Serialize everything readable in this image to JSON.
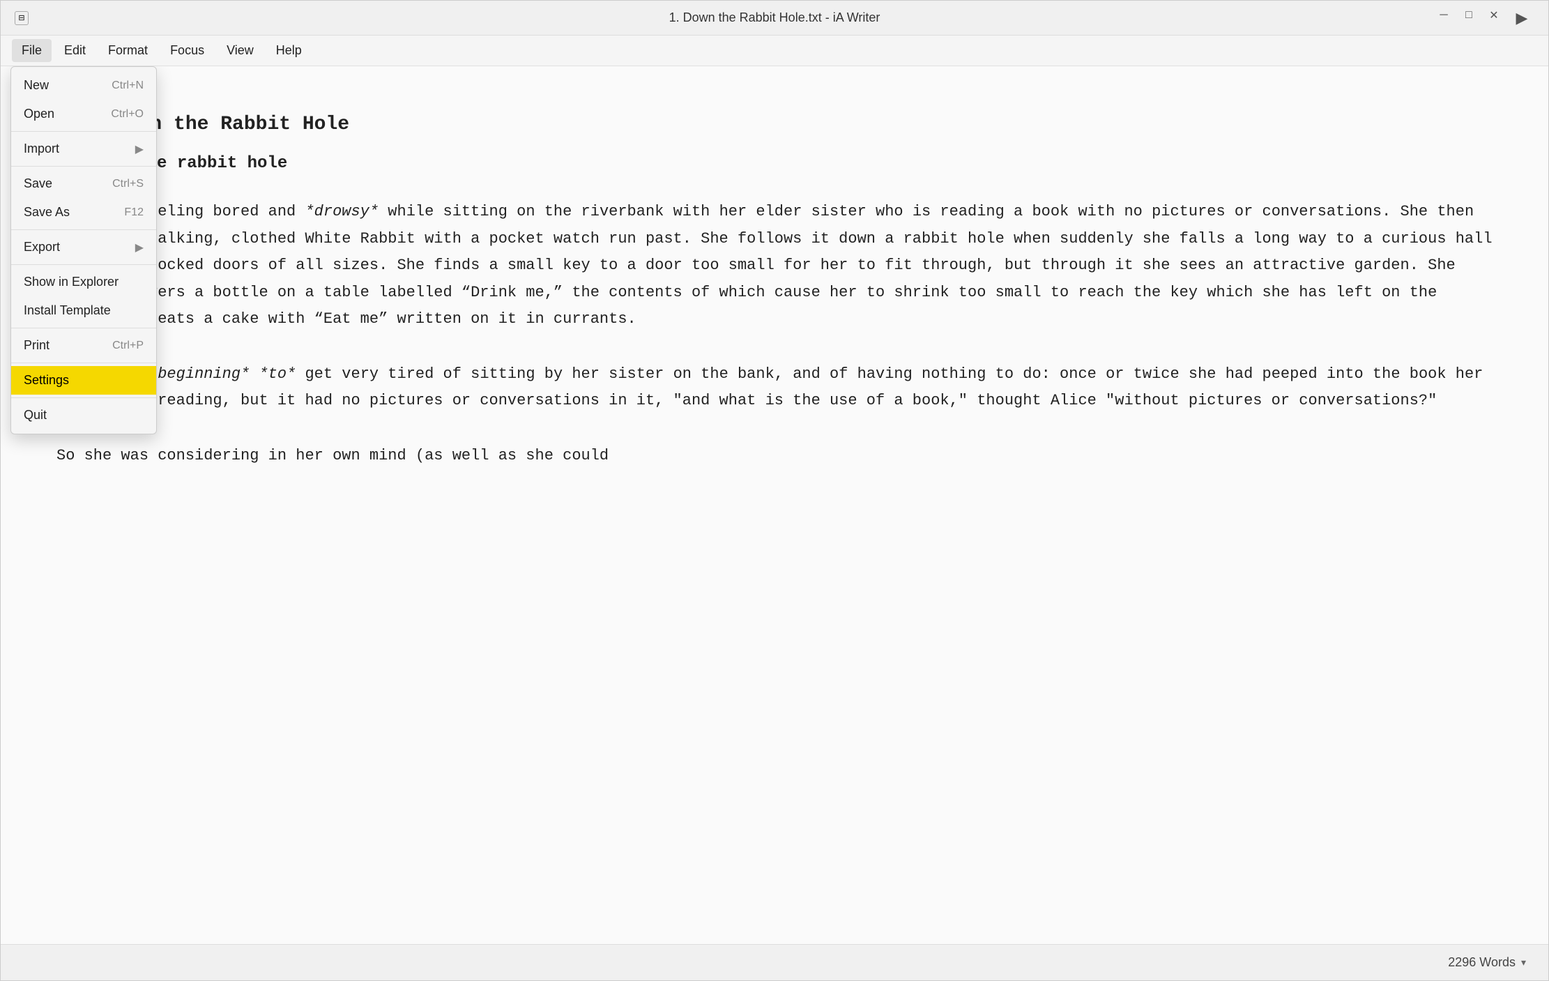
{
  "window": {
    "title": "1. Down the Rabbit Hole.txt - iA Writer"
  },
  "titlebar": {
    "sidebar_toggle_label": "⊟",
    "minimize_label": "─",
    "maximize_label": "□",
    "close_label": "✕",
    "run_label": "▶"
  },
  "menubar": {
    "items": [
      {
        "id": "file",
        "label": "File",
        "active": true
      },
      {
        "id": "edit",
        "label": "Edit"
      },
      {
        "id": "format",
        "label": "Format"
      },
      {
        "id": "focus",
        "label": "Focus"
      },
      {
        "id": "view",
        "label": "View"
      },
      {
        "id": "help",
        "label": "Help"
      }
    ]
  },
  "file_menu": {
    "items": [
      {
        "id": "new",
        "label": "New",
        "shortcut": "Ctrl+N",
        "highlighted": false
      },
      {
        "id": "open",
        "label": "Open",
        "shortcut": "Ctrl+O",
        "highlighted": false
      },
      {
        "id": "divider1",
        "type": "divider"
      },
      {
        "id": "import",
        "label": "Import",
        "arrow": true,
        "highlighted": false
      },
      {
        "id": "divider2",
        "type": "divider"
      },
      {
        "id": "save",
        "label": "Save",
        "shortcut": "Ctrl+S",
        "highlighted": false
      },
      {
        "id": "save-as",
        "label": "Save As",
        "shortcut": "F12",
        "highlighted": false
      },
      {
        "id": "divider3",
        "type": "divider"
      },
      {
        "id": "export",
        "label": "Export",
        "arrow": true,
        "highlighted": false
      },
      {
        "id": "divider4",
        "type": "divider"
      },
      {
        "id": "show-in-explorer",
        "label": "Show in Explorer",
        "highlighted": false
      },
      {
        "id": "install-template",
        "label": "Install Template",
        "highlighted": false
      },
      {
        "id": "divider5",
        "type": "divider"
      },
      {
        "id": "print",
        "label": "Print",
        "shortcut": "Ctrl+P",
        "highlighted": false
      },
      {
        "id": "divider6",
        "type": "divider"
      },
      {
        "id": "settings",
        "label": "Settings",
        "highlighted": true
      },
      {
        "id": "divider7",
        "type": "divider"
      },
      {
        "id": "quit",
        "label": "Quit",
        "highlighted": false
      }
    ]
  },
  "editor": {
    "heading1": "# 1. Down the Rabbit Hole",
    "heading2": "## Into the rabbit hole",
    "paragraph1": "Alice is feeling bored and *drowsy* while sitting on the riverbank with her elder sister who is reading a book with no pictures or conversations. She then notices a talking, clothed White Rabbit with a pocket watch run past. She follows it down a rabbit hole when suddenly she falls a long way to a curious hall with many locked doors of all sizes. She finds a small key to a door too small for her to fit through, but through it she sees an attractive garden. She then discovers a bottle on a table labelled “Drink me,” the contents of which cause her to shrink too small to reach the key which she has left on the table. She eats a cake with “Eat me” written on it in currants.",
    "paragraph2": "Alice was *beginning* *to* get very tired of sitting by her sister on the bank, and of having nothing to do: once or twice she had peeped into the book her sister was reading, but it had no pictures or conversations in it, \"and what is the use of a book,\" thought Alice \"without pictures or conversations?\"",
    "paragraph3_partial": "So she was considering in her own mind (as well as she could"
  },
  "statusbar": {
    "word_count": "2296 Words",
    "chevron": "▾"
  }
}
